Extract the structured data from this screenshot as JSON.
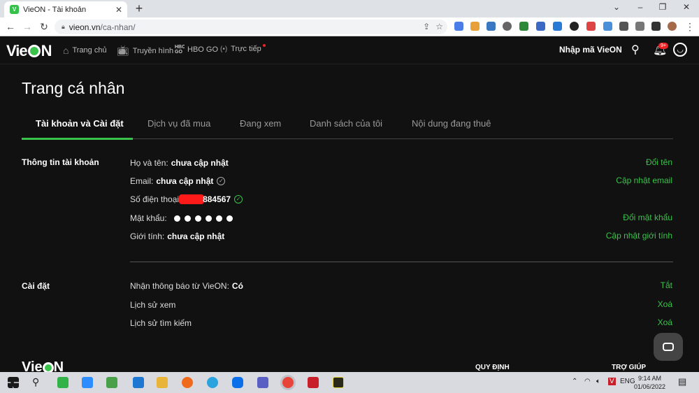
{
  "browser": {
    "tab_title": "VieON - Tài khoản",
    "tab_favicon_text": "V",
    "url_host": "vieon.vn",
    "url_path": "/ca-nhan/"
  },
  "header": {
    "nav": [
      {
        "icon": "home-icon",
        "label": "Trang chủ"
      },
      {
        "icon": "tv-icon",
        "label": "Truyền hình"
      },
      {
        "icon": "hbo-icon",
        "label": "HBO GO"
      },
      {
        "icon": "live-icon",
        "label": "Trực tiếp"
      }
    ],
    "hbo_logo_text": "HBO GO",
    "promo_label": "Nhập mã VieON",
    "notification_badge": "9+"
  },
  "page": {
    "title": "Trang cá nhân",
    "tabs": [
      "Tài khoản và Cài đặt",
      "Dịch vụ đã mua",
      "Đang xem",
      "Danh sách của tôi",
      "Nội dung đang thuê"
    ],
    "active_tab": 0
  },
  "account": {
    "section_label": "Thông tin tài khoản",
    "name_label": "Họ và tên:",
    "name_value": "chưa cập nhật",
    "email_label": "Email:",
    "email_value": "chưa cập nhật",
    "phone_label": "Số điện thoại",
    "phone_suffix": "884567",
    "password_label": "Mật khẩu:",
    "gender_label": "Giới tính:",
    "gender_value": "chưa cập nhật",
    "actions": {
      "rename": "Đổi tên",
      "update_email": "Cập nhật email",
      "change_password": "Đổi mật khẩu",
      "update_gender": "Cập nhật giới tính"
    }
  },
  "settings": {
    "section_label": "Cài đặt",
    "notify_label": "Nhận thông báo từ VieON:",
    "notify_value": "Có",
    "watch_history": "Lịch sử xem",
    "search_history": "Lịch sử tìm kiếm",
    "actions": {
      "notify_off": "Tắt",
      "delete_watch": "Xoá",
      "delete_search": "Xoá"
    }
  },
  "footer": {
    "rules": "QUY ĐỊNH",
    "help": "TRỢ GIÚP"
  },
  "taskbar": {
    "lang": "ENG",
    "time": "9:14 AM",
    "date": "01/06/2022"
  },
  "colors": {
    "accent": "#3ac34a",
    "background": "#111111",
    "redaction": "#ff1a1a"
  }
}
